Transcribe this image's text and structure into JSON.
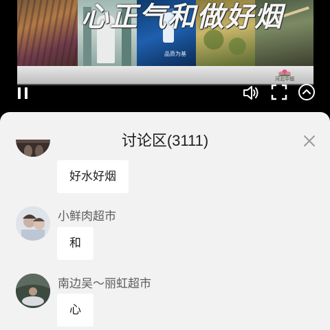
{
  "video": {
    "title_overlay": "心正气和做好烟",
    "caption": "品质为基",
    "logo_text": "河北中烟",
    "progress": 0.0,
    "controls": {
      "pause_icon": "pause-icon",
      "volume_icon": "volume-icon",
      "fullscreen_icon": "fullscreen-icon",
      "expand_icon": "chevron-up-circle-icon"
    }
  },
  "comments_panel": {
    "title": "讨论区(3111)",
    "close_icon": "close-icon",
    "comments": [
      {
        "username": "",
        "text": "好水好烟"
      },
      {
        "username": "小鲜肉超市",
        "text": "和"
      },
      {
        "username": "南边吴～丽虹超市",
        "text": "心"
      }
    ]
  },
  "colors": {
    "sheet_background": "#f2f2f2",
    "bubble_background": "#ffffff",
    "username_text": "#5c5c5c",
    "primary_text": "#1e1e1e"
  }
}
